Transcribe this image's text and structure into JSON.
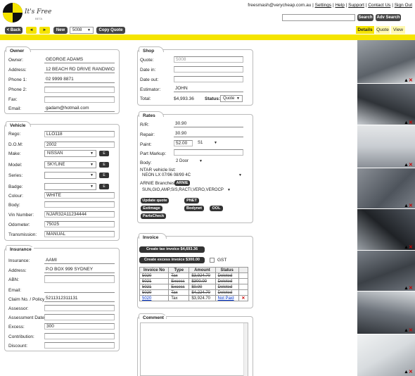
{
  "header": {
    "logo_text": "It's Free",
    "logo_sub": "BETA",
    "user_email": "freesmash@verycheap.com.au",
    "links": [
      "Settings",
      "Help",
      "Support",
      "Contact Us",
      "Sign Out"
    ],
    "search_button": "Search",
    "adv_search_button": "Adv Search"
  },
  "toolbar": {
    "back": "< Back",
    "prev": "◄",
    "next": "►",
    "new": "New",
    "record_select": "5008",
    "copy_quote": "Copy Quote"
  },
  "tabs": [
    "Details",
    "Quote",
    "View"
  ],
  "owner": {
    "title": "Owner",
    "labels": [
      "Owner:",
      "Address:",
      "Phone 1:",
      "Phone 2:",
      "Fax:",
      "Email:"
    ],
    "values": [
      "GEORGE ADAMS",
      "12 BEACH RD DRIVE RANDWICK",
      "02 9999 8871",
      "",
      "",
      "gadam@hotmail.com"
    ]
  },
  "vehicle": {
    "title": "Vehicle",
    "labels": [
      "Rego:",
      "D.O.M:",
      "Make:",
      "Model:",
      "Series:",
      "Badge:",
      "Colour:",
      "Body:",
      "Vin Number:",
      "Odometer:",
      "Transmission:"
    ],
    "rego": "LLO118",
    "dom": "2002",
    "make": "NISSAN",
    "model": "SKYLINE",
    "series": "",
    "badge": "",
    "colour": "WHITE",
    "body": "",
    "vin": "NJAR32A11234444",
    "odometer": "75025",
    "transmission": "MANUAL",
    "e_button": "E"
  },
  "insurance": {
    "title": "Insurance",
    "labels": [
      "Insurance:",
      "Address:",
      "ABN:",
      "Email:",
      "Claim No. / Policy:",
      "Assessor:",
      "Assessment Date:",
      "Excess:",
      "Contribution:",
      "Discount:"
    ],
    "values": [
      "AAMI",
      "P.O BOX 999 SYDNEY",
      "",
      "",
      "5211312311131",
      "",
      "",
      "300",
      "",
      ""
    ]
  },
  "shop": {
    "title": "Shop",
    "labels": [
      "Quote:",
      "Date in:",
      "Date out:",
      "Estimator:",
      "Total:"
    ],
    "quote": "5008",
    "date_in": "",
    "date_out": "",
    "estimator": "JOHN",
    "total": "$4,993.36",
    "status_label": "Status:",
    "status_value": "Quote"
  },
  "rates": {
    "title": "Rates",
    "labels": [
      "R/R:",
      "Repair:",
      "Paint:",
      "Part Markup:",
      "Body:"
    ],
    "rr": "30.90",
    "repair": "30.90",
    "paint": "52.00",
    "paint_code": "S1",
    "part_markup": "",
    "body": "2 Door",
    "ntar_label": "NTAR vehicle list:",
    "ntar_value": "NEON LX 07/96 08/99 4C",
    "arnie_label": "ARNIE Branches",
    "arnie_button": "ARNIE",
    "branches_value": "SUN,GIO,AMP,SIS,RACTI,VERO,VEROCP",
    "buttons": [
      "Update quote",
      "PNET",
      "Estimage",
      "Bodynet",
      "OOL",
      "PartsCheck"
    ]
  },
  "invoice": {
    "title": "Invoice",
    "create_tax": "Create tax invoice $4,693.36",
    "create_excess": "Create excess invoice $300.00",
    "gst_label": "GST",
    "headers": [
      "Invoice No",
      "Type",
      "Amount",
      "Status"
    ],
    "rows": [
      {
        "no": "5020",
        "type": "Tax",
        "amount": "$3,924.70",
        "status": "Deleted",
        "struck": true
      },
      {
        "no": "5021",
        "type": "Excess",
        "amount": "$300.00",
        "status": "Deleted",
        "struck": true
      },
      {
        "no": "5021",
        "type": "Excess",
        "amount": "$0.00",
        "status": "Deleted",
        "struck": true
      },
      {
        "no": "5020",
        "type": "Tax",
        "amount": "$4,224.70",
        "status": "Deleted",
        "struck": true
      },
      {
        "no": "5020",
        "type": "Tax",
        "amount": "$3,924.70",
        "status": "Not Paid",
        "struck": false
      }
    ]
  },
  "comment": {
    "title": "Comment",
    "value": ""
  },
  "photos": {
    "up_icon": "▲",
    "delete_icon": "✕",
    "colors": [
      "#8a8f96",
      "#6e747c",
      "#c9cdd2",
      "#5b6168",
      "#7a8088",
      "#4e545c",
      "#9aa0a6",
      "#d8dcdf"
    ]
  }
}
